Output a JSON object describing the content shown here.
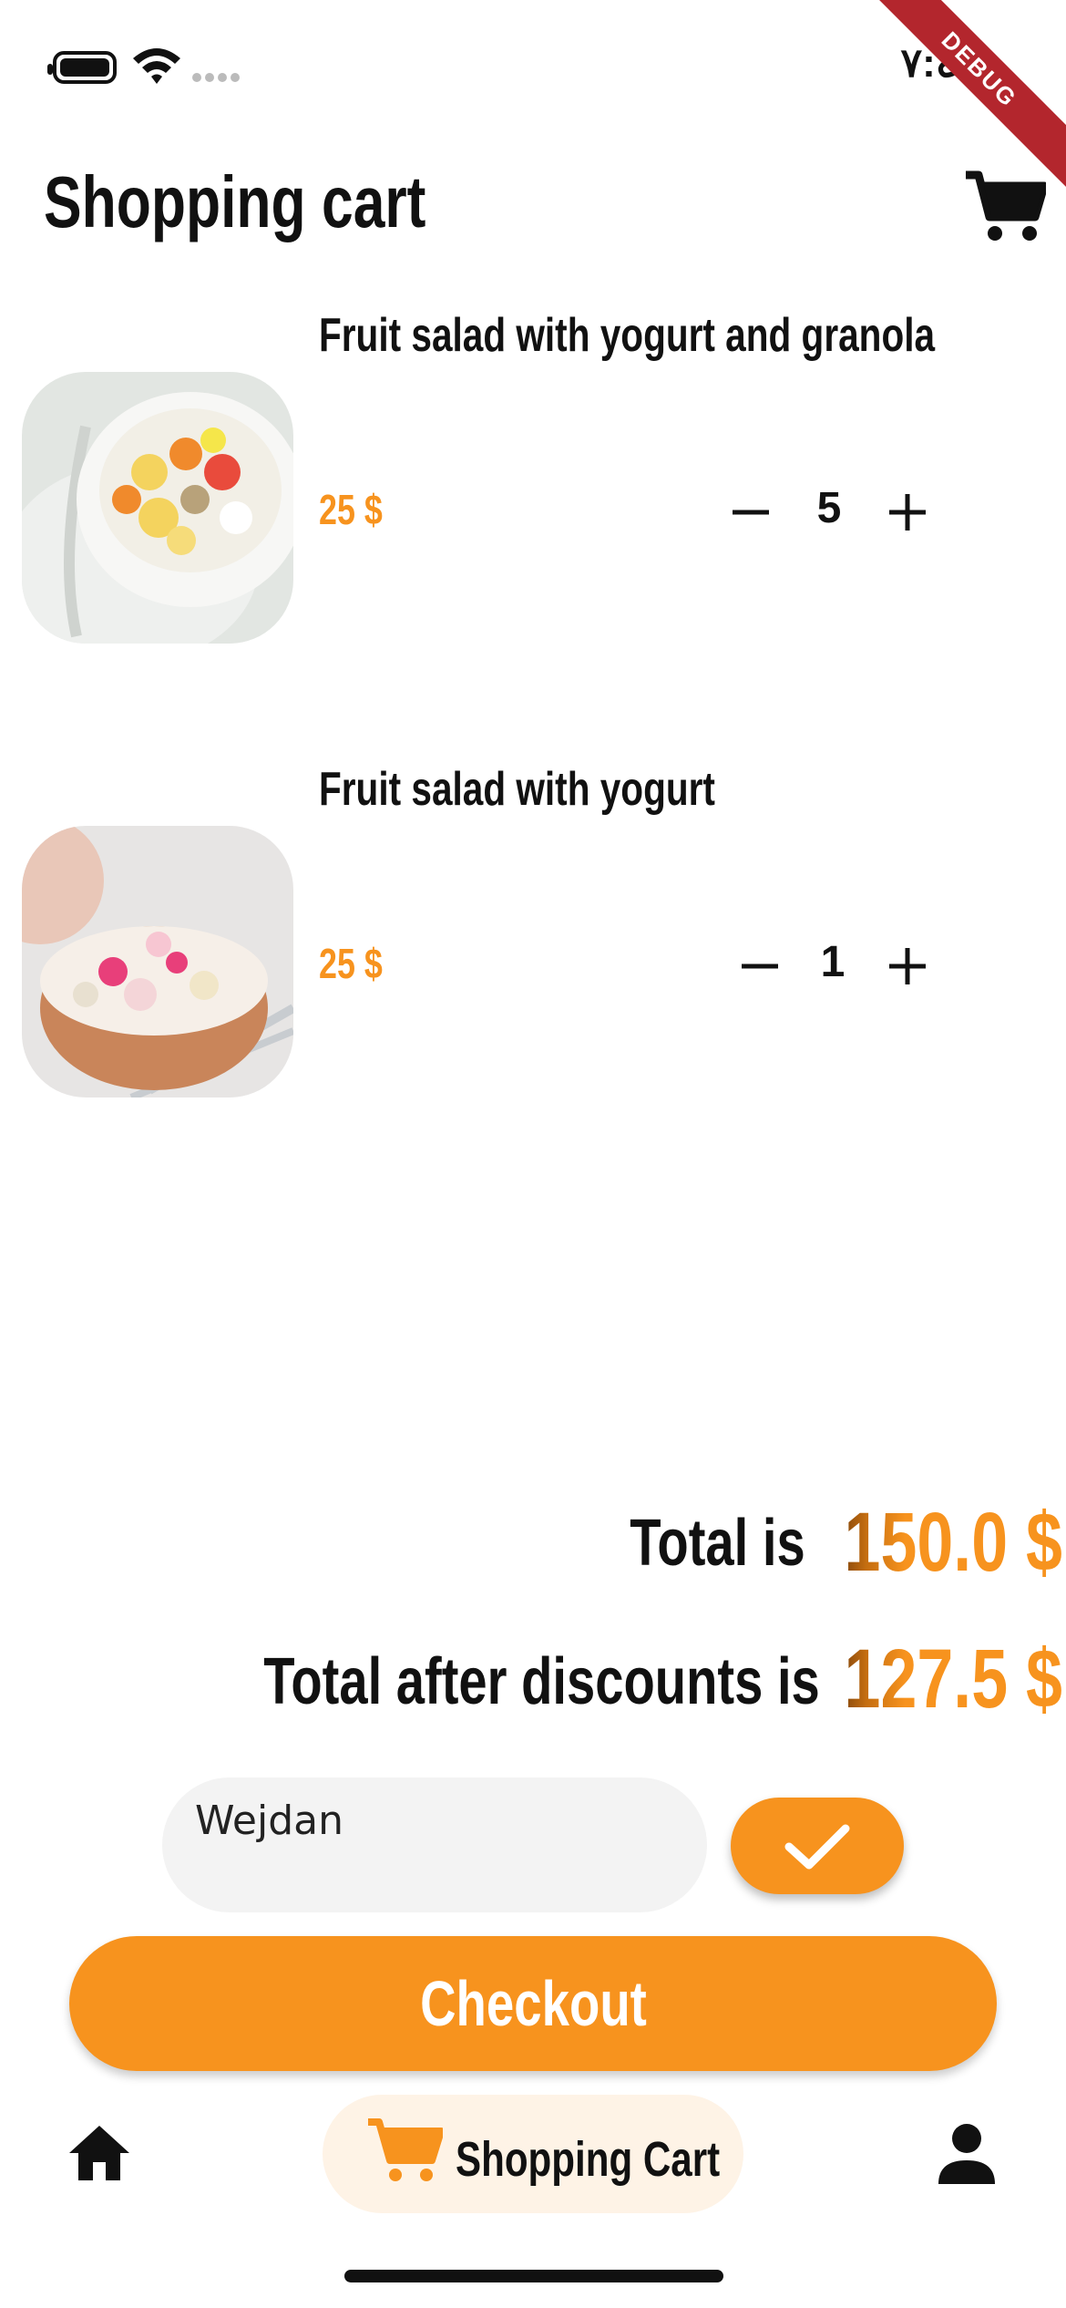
{
  "status_bar": {
    "time": "٧:٤٠"
  },
  "debug_banner": {
    "label": "DEBUG"
  },
  "header": {
    "title": "Shopping cart",
    "cart_icon": "cart-icon"
  },
  "cart": {
    "items": [
      {
        "name": "Fruit salad with yogurt and granola",
        "price": "25 $",
        "quantity": "5"
      },
      {
        "name": "Fruit salad with yogurt",
        "price": "25 $",
        "quantity": "1"
      }
    ]
  },
  "totals": {
    "total_label": "Total is",
    "total_value": "150.0 $",
    "discount_label": "Total after discounts is",
    "discount_value": "127.5 $"
  },
  "coupon": {
    "value": "Wejdan",
    "confirm_icon": "check-icon"
  },
  "checkout": {
    "label": "Checkout"
  },
  "bottom_nav": {
    "items": [
      {
        "icon": "home-icon",
        "label": ""
      },
      {
        "icon": "cart-icon",
        "label": "Shopping Cart",
        "active": true
      },
      {
        "icon": "person-icon",
        "label": ""
      }
    ]
  },
  "colors": {
    "accent": "#f7931e",
    "accent_light": "#fef3e6",
    "debug": "#b3262d"
  }
}
